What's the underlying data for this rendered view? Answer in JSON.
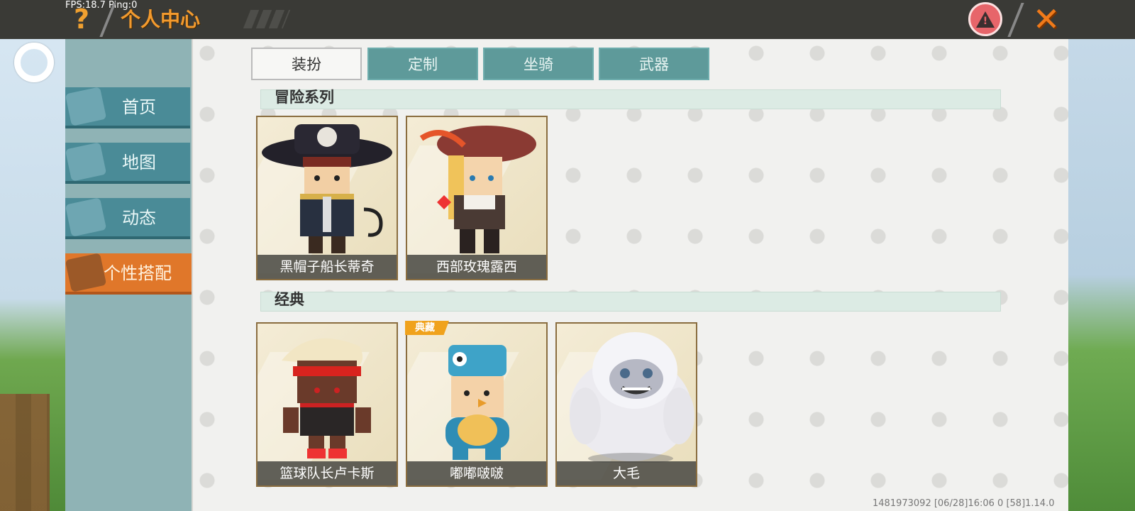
{
  "topbar": {
    "fps_text": "FPS:18.7  Ping:0",
    "help_symbol": "?",
    "title": "个人中心",
    "warn_symbol": "!",
    "close_symbol": "✕"
  },
  "sidebar": {
    "items": [
      {
        "label": "首页",
        "icon": "house-icon"
      },
      {
        "label": "地图",
        "icon": "map-icon"
      },
      {
        "label": "动态",
        "icon": "bell-icon"
      },
      {
        "label": "个性搭配",
        "icon": "character-icon",
        "active": true
      }
    ]
  },
  "tabs": [
    {
      "label": "装扮",
      "selected": true
    },
    {
      "label": "定制",
      "selected": false
    },
    {
      "label": "坐骑",
      "selected": false
    },
    {
      "label": "武器",
      "selected": false
    }
  ],
  "sections": [
    {
      "title": "冒险系列",
      "cards": [
        {
          "name": "黑帽子船长蒂奇"
        },
        {
          "name": "西部玫瑰露西"
        }
      ]
    },
    {
      "title": "经典",
      "cards": [
        {
          "name": "篮球队长卢卡斯"
        },
        {
          "name": "嘟嘟啵啵",
          "badge": "典藏"
        },
        {
          "name": "大毛"
        }
      ]
    }
  ],
  "footer": {
    "info": "1481973092    [06/28]16:06 0  [58]1.14.0"
  },
  "colors": {
    "accent_orange": "#e0772a",
    "tab_teal": "#5e9a9a",
    "topbar": "#3a3a36"
  }
}
